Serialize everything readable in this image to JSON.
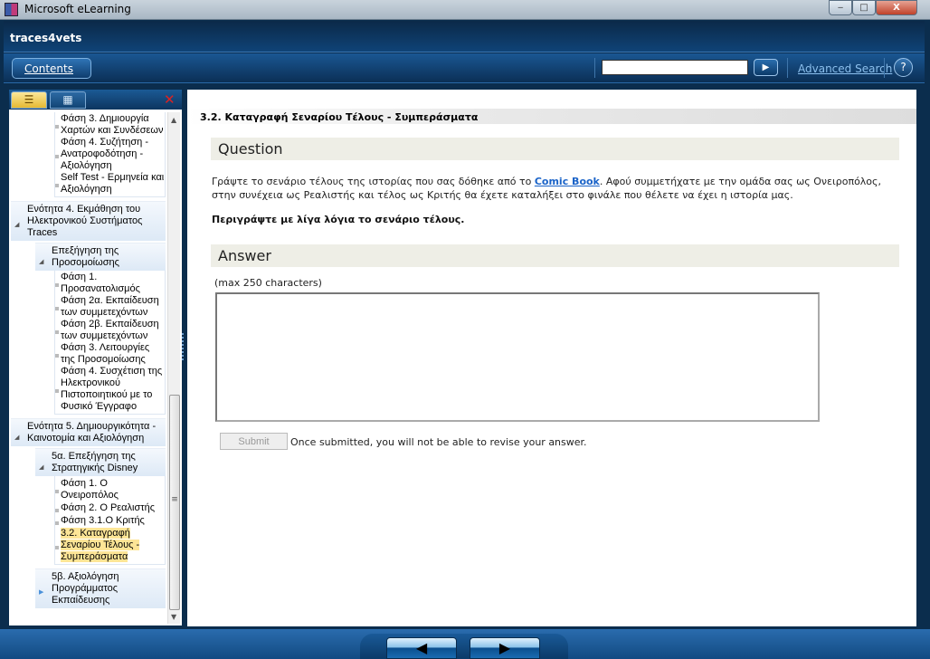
{
  "window": {
    "title": "Microsoft eLearning",
    "minimize": "‒",
    "maximize": "□",
    "close": "X"
  },
  "header": {
    "course_title": "traces4vets"
  },
  "toolbar": {
    "contents_label": "Contents",
    "search_value": "",
    "search_go": "▶",
    "advanced_search": "Advanced Search",
    "help": "?"
  },
  "sidebar": {
    "tab_list_icon": "☰",
    "tab_grid_icon": "▦",
    "close_icon": "✕",
    "tree": {
      "top_leaves": [
        "Φάση 3. Δημιουργία Χαρτών και Συνδέσεων",
        "Φάση 4. Συζήτηση - Ανατροφοδότηση - Αξιολόγηση",
        "Self Test - Ερμηνεία και Αξιολόγηση"
      ],
      "unit4": "Ενότητα 4. Εκμάθηση του Ηλεκτρονικού Συστήματος Traces",
      "unit4_sub": "Επεξήγηση της Προσομοίωσης",
      "unit4_leaves": [
        "Φάση 1. Προσανατολισμός",
        "Φάση 2α. Εκπαίδευση των συμμετεχόντων",
        "Φάση 2β. Εκπαίδευση των συμμετεχόντων",
        "Φάση 3. Λειτουργίες της Προσομοίωσης",
        "Φάση 4. Συσχέτιση της Ηλεκτρονικού Πιστοποιητικού με το Φυσικό Έγγραφο"
      ],
      "unit5": "Ενότητα 5. Δημιουργικότητα - Καινοτομία και Αξιολόγηση",
      "unit5_sub_a": "5α. Επεξήγηση της Στρατηγικής Disney",
      "unit5_leaves": [
        "Φάση 1. Ο Ονειροπόλος",
        "Φάση 2. Ο Ρεαλιστής",
        "Φάση 3.1.Ο Κριτής",
        "3.2. Καταγραφή Σεναρίου Τέλους - Συμπεράσματα"
      ],
      "unit5_sub_b": "5β. Αξιολόγηση Προγράμματος Εκπαίδευσης"
    }
  },
  "content": {
    "topic_title": "3.2. Καταγραφή Σεναρίου Τέλους - Συμπεράσματα",
    "question_heading": "Question",
    "para_before": "Γράψτε το σενάριο τέλους της ιστορίας που σας δόθηκε από το ",
    "link": "Comic Book",
    "para_after": ". Αφού συμμετήχατε με την ομάδα σας ως Ονειροπόλος, στην συνέχεια ως Ρεαλιστής και τέλος ως Κριτής θα έχετε καταλήξει στο φινάλε που θέλετε να έχει η ιστορία μας.",
    "prompt": "Περιγράψτε με λίγα λόγια το σενάριο τέλους.",
    "answer_heading": "Answer",
    "max_chars": "(max 250 characters)",
    "answer_value": "",
    "submit": "Submit",
    "submit_note": "Once submitted, you will not be able to revise your answer."
  },
  "footer": {
    "prev": "◀",
    "next": "▶"
  }
}
